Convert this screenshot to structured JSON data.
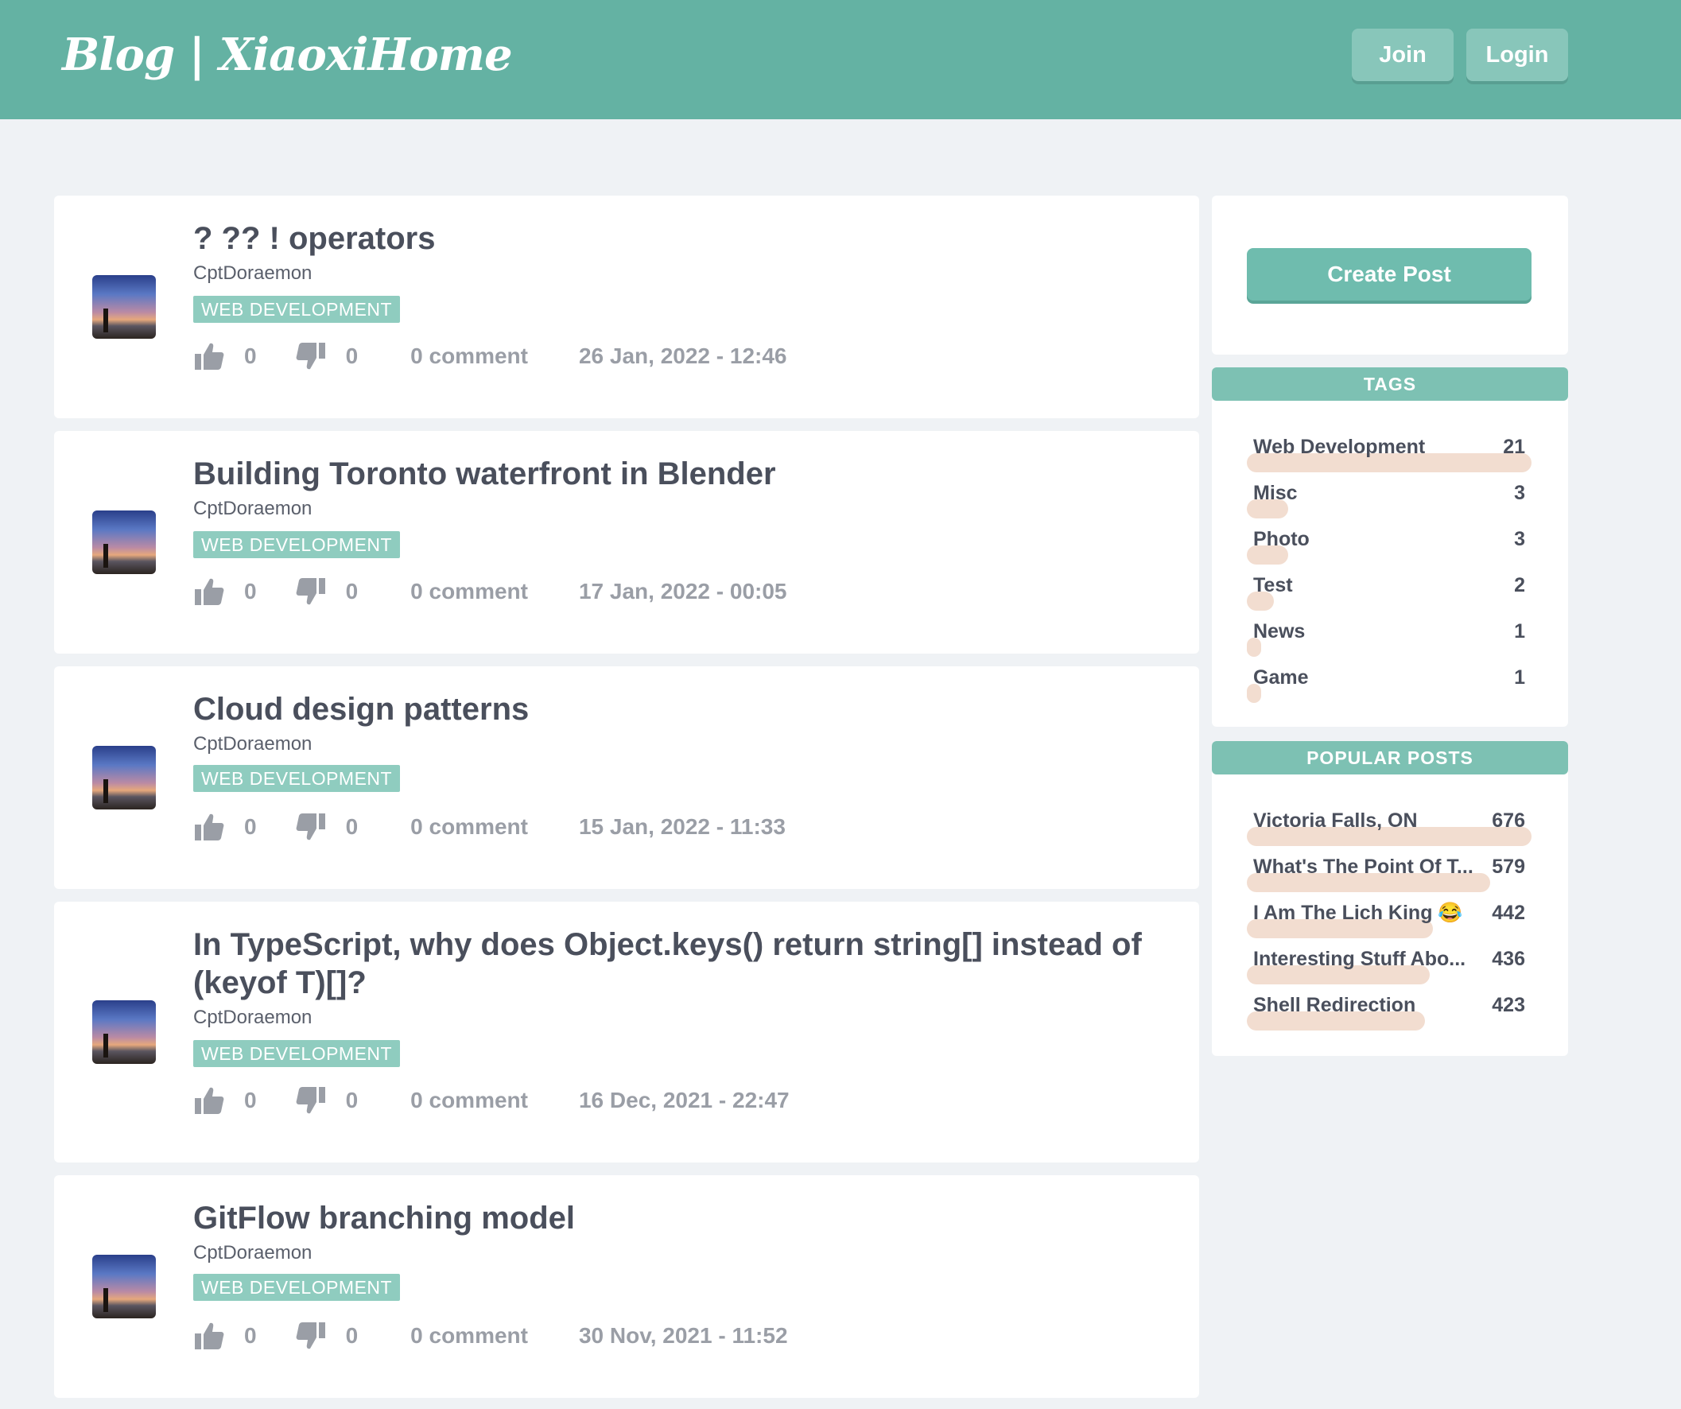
{
  "header": {
    "brand": "Blog | XiaoxiHome",
    "join_label": "Join",
    "login_label": "Login"
  },
  "posts": [
    {
      "title": "? ?? ! operators",
      "author": "CptDoraemon",
      "tag": "WEB DEVELOPMENT",
      "likes": "0",
      "dislikes": "0",
      "comments": "0 comment",
      "date": "26 Jan, 2022 - 12:46"
    },
    {
      "title": "Building Toronto waterfront in Blender",
      "author": "CptDoraemon",
      "tag": "WEB DEVELOPMENT",
      "likes": "0",
      "dislikes": "0",
      "comments": "0 comment",
      "date": "17 Jan, 2022 - 00:05"
    },
    {
      "title": "Cloud design patterns",
      "author": "CptDoraemon",
      "tag": "WEB DEVELOPMENT",
      "likes": "0",
      "dislikes": "0",
      "comments": "0 comment",
      "date": "15 Jan, 2022 - 11:33"
    },
    {
      "title": "In TypeScript, why does Object.keys() return string[] instead of (keyof T)[]?",
      "author": "CptDoraemon",
      "tag": "WEB DEVELOPMENT",
      "likes": "0",
      "dislikes": "0",
      "comments": "0 comment",
      "date": "16 Dec, 2021 - 22:47"
    },
    {
      "title": "GitFlow branching model",
      "author": "CptDoraemon",
      "tag": "WEB DEVELOPMENT",
      "likes": "0",
      "dislikes": "0",
      "comments": "0 comment",
      "date": "30 Nov, 2021 - 11:52"
    }
  ],
  "sidebar": {
    "create_post_label": "Create Post",
    "tags_heading": "TAGS",
    "tags": [
      {
        "label": "Web Development",
        "count": "21"
      },
      {
        "label": "Misc",
        "count": "3"
      },
      {
        "label": "Photo",
        "count": "3"
      },
      {
        "label": "Test",
        "count": "2"
      },
      {
        "label": "News",
        "count": "1"
      },
      {
        "label": "Game",
        "count": "1"
      }
    ],
    "popular_heading": "POPULAR POSTS",
    "popular": [
      {
        "label": "Victoria Falls, ON",
        "count": "676"
      },
      {
        "label": "What's The Point Of T...",
        "count": "579"
      },
      {
        "label": "I Am The Lich King 😂",
        "count": "442"
      },
      {
        "label": "Interesting Stuff Abo...",
        "count": "436"
      },
      {
        "label": "Shell Redirection",
        "count": "423"
      }
    ]
  },
  "colors": {
    "accent": "#64b2a3",
    "bar": "#f2ddd0",
    "background": "#eff2f5"
  }
}
